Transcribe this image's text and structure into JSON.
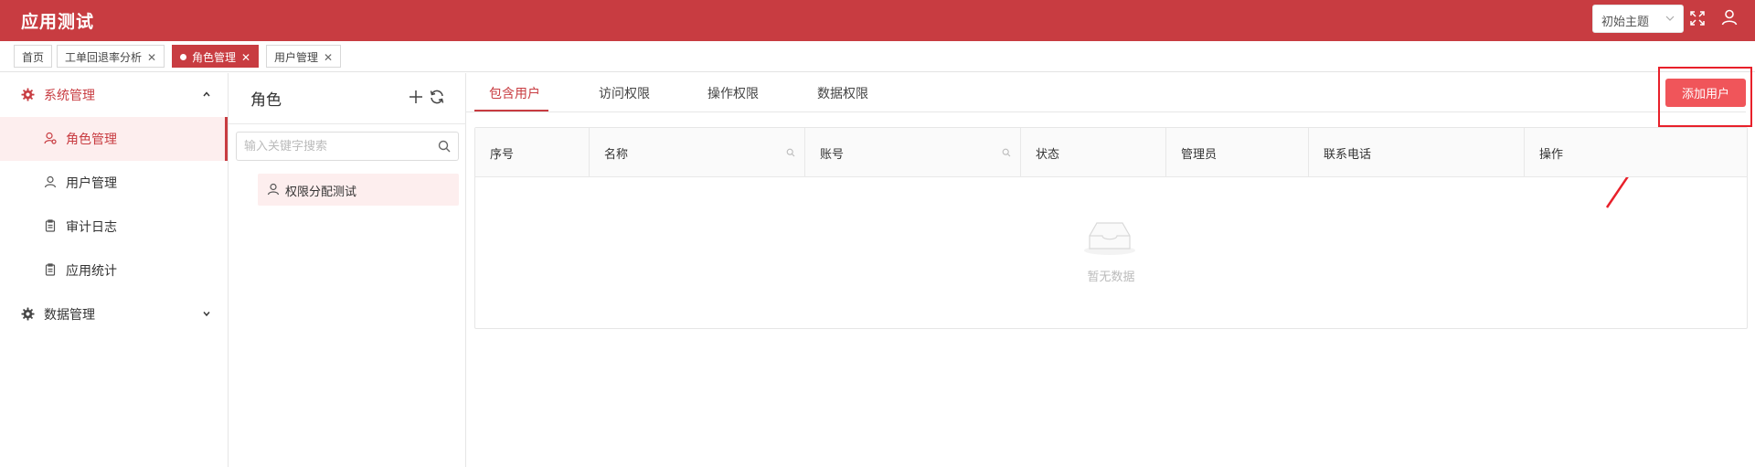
{
  "header": {
    "app_title": "应用测试",
    "theme_label": "初始主题",
    "accent_color": "#c83c41"
  },
  "tabbar": {
    "tabs": [
      {
        "label": "首页",
        "closable": false,
        "active": false
      },
      {
        "label": "工单回退率分析",
        "closable": true,
        "active": false
      },
      {
        "label": "角色管理",
        "closable": true,
        "active": true
      },
      {
        "label": "用户管理",
        "closable": true,
        "active": false
      }
    ],
    "close_glyph": "✕"
  },
  "sidebar": {
    "groups": [
      {
        "label": "系统管理",
        "icon": "gear-icon",
        "expanded": true
      },
      {
        "label": "数据管理",
        "icon": "gear-icon",
        "expanded": false
      }
    ],
    "items": [
      {
        "label": "角色管理",
        "icon": "role-icon",
        "active": true
      },
      {
        "label": "用户管理",
        "icon": "user-icon",
        "active": false
      },
      {
        "label": "审计日志",
        "icon": "clipboard-icon",
        "active": false
      },
      {
        "label": "应用统计",
        "icon": "clipboard-icon",
        "active": false
      }
    ]
  },
  "role_panel": {
    "title": "角色",
    "search_placeholder": "输入关键字搜索",
    "roles": [
      {
        "label": "权限分配测试",
        "selected": true
      }
    ]
  },
  "main": {
    "tabs": [
      {
        "label": "包含用户",
        "active": true
      },
      {
        "label": "访问权限",
        "active": false
      },
      {
        "label": "操作权限",
        "active": false
      },
      {
        "label": "数据权限",
        "active": false
      }
    ],
    "add_user_label": "添加用户",
    "table": {
      "columns": [
        {
          "label": "序号",
          "filterable": false
        },
        {
          "label": "名称",
          "filterable": true
        },
        {
          "label": "账号",
          "filterable": true
        },
        {
          "label": "状态",
          "filterable": false
        },
        {
          "label": "管理员",
          "filterable": false
        },
        {
          "label": "联系电话",
          "filterable": false
        },
        {
          "label": "操作",
          "filterable": false
        }
      ],
      "rows": [],
      "empty_text": "暂无数据"
    }
  }
}
